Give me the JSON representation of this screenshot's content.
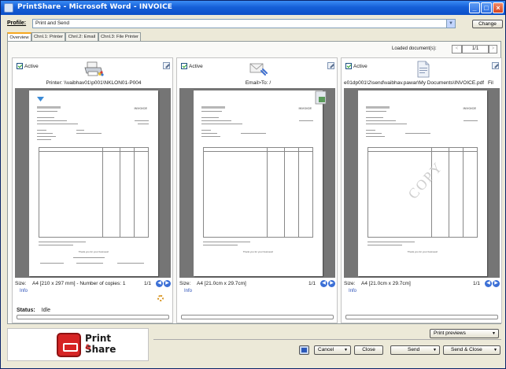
{
  "window": {
    "title": "PrintShare - Microsoft Word - INVOICE"
  },
  "profile": {
    "label": "Profile:",
    "value": "Print and Send",
    "change_label": "Change"
  },
  "tabs": [
    {
      "label": "Overview",
      "active": true
    },
    {
      "label": "Chnl.1: Printer",
      "active": false
    },
    {
      "label": "Chnl.2: Email",
      "active": false
    },
    {
      "label": "Chnl.3: File Printer",
      "active": false
    }
  ],
  "documents": {
    "label": "Loaded document(s):",
    "page": "1/1",
    "prev": "<",
    "next": ">"
  },
  "cards": [
    {
      "active_label": "Active",
      "icon": "printer-icon",
      "target": "Printer: \\\\vaibhav01\\p001\\NKLON01-P004",
      "size_label": "Size:",
      "size_value": "A4 [210 x 297 mm] - Number of copies: 1",
      "pages": "1/1",
      "info_label": "Info",
      "status_label": "Status:",
      "status_value": "Idle",
      "invoice_word": "INVOICE",
      "thanks": "Thank you for your business!"
    },
    {
      "active_label": "Active",
      "icon": "email-icon",
      "target": "Email>To: /",
      "size_label": "Size:",
      "size_value": "A4 [21.0cm x 29.7cm]",
      "pages": "1/1",
      "info_label": "Info",
      "invoice_word": "INVOICE",
      "thanks": "Thank you for your business!"
    },
    {
      "active_label": "Active",
      "icon": "file-icon",
      "target": "e01dp001\\2\\send\\vaibhav.pawar\\My Documents\\INVOICE.pdf",
      "target_suffix": "Fil",
      "size_label": "Size:",
      "size_value": "A4 [21.0cm x 29.7cm]",
      "pages": "1/1",
      "info_label": "Info",
      "invoice_word": "INVOICE",
      "copy_stamp": "COPY",
      "thanks": "Thank you for your business!"
    }
  ],
  "bottom": {
    "logo_line1": "Print",
    "logo_amp": "&",
    "logo_line2": "Share",
    "print_previews": "Print previews",
    "cancel": "Cancel",
    "close": "Close",
    "send": "Send",
    "send_close": "Send & Close"
  },
  "colors": {
    "titlebar": "#1660d8",
    "preview_bg": "#757575",
    "accent_tab": "#f6a71f"
  }
}
